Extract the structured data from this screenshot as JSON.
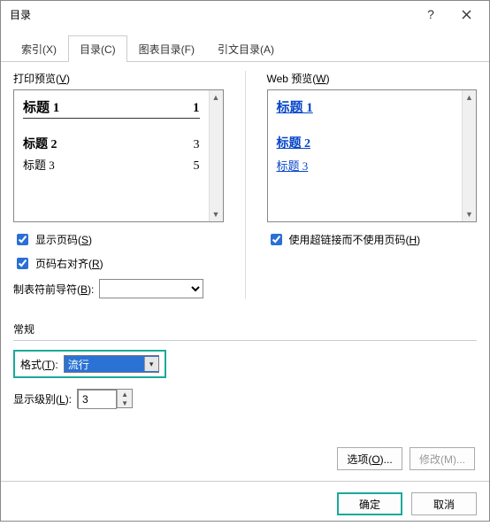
{
  "titlebar": {
    "title": "目录"
  },
  "tabs": {
    "index": "索引(X)",
    "toc": "目录(C)",
    "figures": "图表目录(F)",
    "authorities": "引文目录(A)"
  },
  "printPreview": {
    "label_pre": "打印预览(",
    "label_key": "V",
    "label_post": ")",
    "lines": [
      {
        "title": "标题 1",
        "page": "1"
      },
      {
        "title": "标题 2",
        "page": "3"
      },
      {
        "title": "标题 3",
        "page": "5"
      }
    ]
  },
  "webPreview": {
    "label_pre": "Web 预览(",
    "label_key": "W",
    "label_post": ")",
    "links": [
      "标题 1",
      "标题 2",
      "标题 3"
    ]
  },
  "checks": {
    "showPageNumbers_pre": "显示页码(",
    "showPageNumbers_key": "S",
    "showPageNumbers_post": ")",
    "rightAlign_pre": "页码右对齐(",
    "rightAlign_key": "R",
    "rightAlign_post": ")",
    "hyperlinks_pre": "使用超链接而不使用页码(",
    "hyperlinks_key": "H",
    "hyperlinks_post": ")"
  },
  "tabLeader": {
    "label_pre": "制表符前导符(",
    "label_key": "B",
    "label_post": "):",
    "value": ""
  },
  "general": {
    "heading": "常规",
    "format_label_pre": "格式(",
    "format_label_key": "T",
    "format_label_post": "):",
    "format_value": "流行",
    "levels_label_pre": "显示级别(",
    "levels_label_key": "L",
    "levels_label_post": "):",
    "levels_value": "3"
  },
  "buttons": {
    "options": "选项(O)...",
    "modify": "修改(M)...",
    "ok": "确定",
    "cancel": "取消"
  }
}
